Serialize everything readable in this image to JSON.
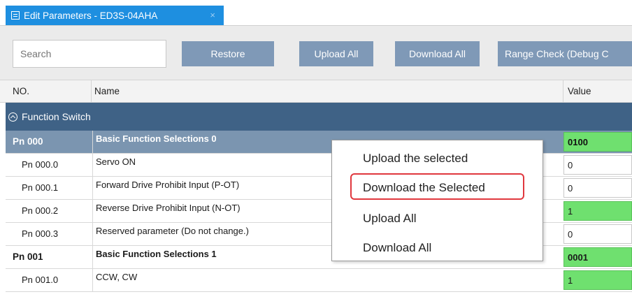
{
  "tab": {
    "title": "Edit Parameters - ED3S-04AHA",
    "close": "×"
  },
  "toolbar": {
    "search_placeholder": "Search",
    "restore": "Restore",
    "upload_all": "Upload All",
    "download_all": "Download All",
    "range_check": "Range Check (Debug C"
  },
  "table": {
    "headers": {
      "no": "NO.",
      "name": "Name",
      "value": "Value"
    },
    "group": "Function Switch",
    "rows": [
      {
        "no": "Pn 000",
        "name": "Basic Function Selections 0",
        "value": "0100",
        "green": true,
        "parent": true,
        "selected": true
      },
      {
        "no": "Pn 000.0",
        "name": "Servo ON",
        "value": "0",
        "green": false
      },
      {
        "no": "Pn 000.1",
        "name": "Forward Drive Prohibit Input (P-OT)",
        "value": "0",
        "green": false
      },
      {
        "no": "Pn 000.2",
        "name": "Reverse Drive Prohibit Input (N-OT)",
        "value": "1",
        "green": true
      },
      {
        "no": "Pn 000.3",
        "name": "Reserved parameter (Do not change.)",
        "value": "0",
        "green": false
      },
      {
        "no": "Pn 001",
        "name": "Basic Function Selections 1",
        "value": "0001",
        "green": true,
        "parent": true
      },
      {
        "no": "Pn 001.0",
        "name": "CCW, CW",
        "value": "1",
        "green": true
      }
    ]
  },
  "context_menu": {
    "items": [
      "Upload the selected",
      "Download the Selected",
      "Upload All",
      "Download All"
    ],
    "highlighted_index": 1,
    "highlight_color": "#e0383e"
  },
  "colors": {
    "tab": "#1e8fe0",
    "group": "#3f6286",
    "selected_row": "#7b95b0",
    "value_green": "#6fe06f",
    "button": "#7f99b7"
  }
}
